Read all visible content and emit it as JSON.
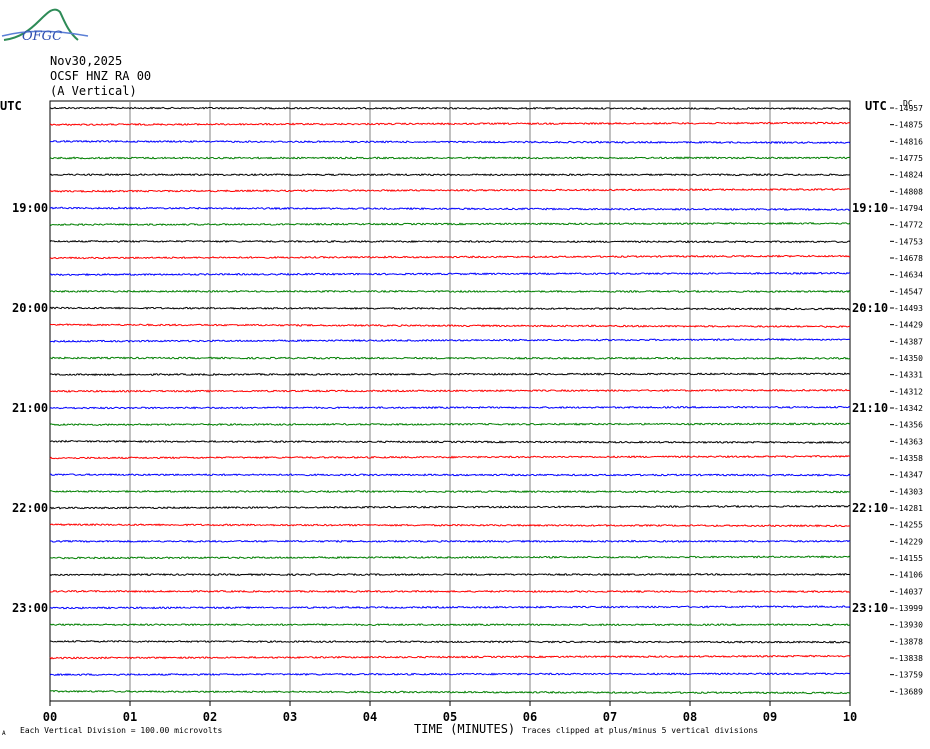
{
  "header": {
    "logo_text": "OFGC",
    "date": "Nov30,2025",
    "station": "OCSF HNZ RA 00",
    "component": "(A Vertical)",
    "utc_left": "UTC",
    "utc_right": "UTC",
    "dc_label": "DC"
  },
  "chart_data": {
    "type": "line",
    "xlabel": "TIME (MINUTES)",
    "x_ticks": [
      "00",
      "01",
      "02",
      "03",
      "04",
      "05",
      "06",
      "07",
      "08",
      "09",
      "10"
    ],
    "xlim": [
      0,
      10
    ],
    "left_time_labels": [
      {
        "row": 6,
        "label": "19:00"
      },
      {
        "row": 12,
        "label": "20:00"
      },
      {
        "row": 18,
        "label": "21:00"
      },
      {
        "row": 24,
        "label": "22:00"
      },
      {
        "row": 30,
        "label": "23:00"
      }
    ],
    "right_time_labels": [
      {
        "row": 6,
        "label": "19:10"
      },
      {
        "row": 12,
        "label": "20:10"
      },
      {
        "row": 18,
        "label": "21:10"
      },
      {
        "row": 24,
        "label": "22:10"
      },
      {
        "row": 30,
        "label": "23:10"
      }
    ],
    "trace_colors": [
      "#000000",
      "#ff0000",
      "#0000ff",
      "#007f00"
    ],
    "dc_offsets": [
      "-14957",
      "-14875",
      "-14816",
      "-14775",
      "-14824",
      "-14808",
      "-14794",
      "-14772",
      "-14753",
      "-14678",
      "-14634",
      "-14547",
      "-14493",
      "-14429",
      "-14387",
      "-14350",
      "-14331",
      "-14312",
      "-14342",
      "-14356",
      "-14363",
      "-14358",
      "-14347",
      "-14303",
      "-14281",
      "-14255",
      "-14229",
      "-14155",
      "-14106",
      "-14037",
      "-13999",
      "-13930",
      "-13878",
      "-13838",
      "-13759",
      "-13689"
    ],
    "footer_left": "Each Vertical Division =  100.00 microvolts",
    "footer_right": "Traces clipped at plus/minus 5 vertical divisions",
    "footer_mark": "A",
    "grid": true
  }
}
